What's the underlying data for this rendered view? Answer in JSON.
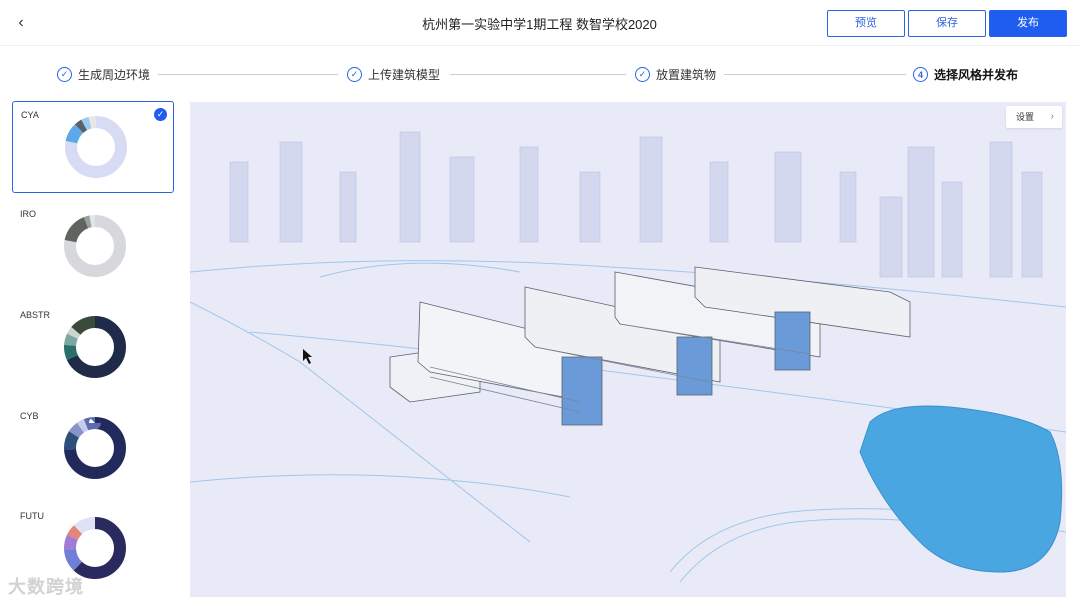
{
  "header": {
    "back_icon": "chevron-left-icon",
    "title": "杭州第一实验中学1期工程 数智学校2020",
    "preview_label": "预览",
    "save_label": "保存",
    "publish_label": "发布"
  },
  "steps": [
    {
      "label": "生成周边环境",
      "icon": "check-circle-icon",
      "mark": "✓"
    },
    {
      "label": "上传建筑模型",
      "icon": "check-circle-icon",
      "mark": "✓"
    },
    {
      "label": "放置建筑物",
      "icon": "check-circle-icon",
      "mark": "✓"
    },
    {
      "label": "选择风格并发布",
      "icon": "number-circle-icon",
      "mark": "4"
    }
  ],
  "styles": [
    {
      "name": "CYA",
      "selected": true,
      "colors": [
        "#d8dbf4",
        "#5ba9ea",
        "#5b5f66",
        "#9ccbef",
        "#e7e7e7"
      ],
      "values": [
        78,
        10,
        4,
        4,
        4
      ]
    },
    {
      "name": "IRO",
      "selected": false,
      "colors": [
        "#d7d8dc",
        "#5f645d",
        "#9aa09a",
        "#e3e4e6"
      ],
      "values": [
        78,
        16,
        3,
        3
      ]
    },
    {
      "name": "ABSTR",
      "selected": false,
      "colors": [
        "#1f2b48",
        "#2b6f6c",
        "#7aa7a0",
        "#c9d6d2",
        "#3b4a3a"
      ],
      "values": [
        68,
        8,
        6,
        4,
        14
      ]
    },
    {
      "name": "CYB",
      "selected": false,
      "colors": [
        "#222a5c",
        "#2e4f7a",
        "#8a93c8",
        "#c6ccee",
        "#5f6bb0"
      ],
      "values": [
        74,
        10,
        6,
        4,
        6
      ]
    },
    {
      "name": "FUTU",
      "selected": false,
      "colors": [
        "#2a2a5e",
        "#6f7fd8",
        "#a17bd6",
        "#e3877a",
        "#dfe2f6"
      ],
      "values": [
        62,
        12,
        8,
        6,
        12
      ]
    }
  ],
  "viewport": {
    "settings_label": "设置",
    "settings_icon": "chevron-right-icon"
  },
  "watermark": "大数跨境"
}
